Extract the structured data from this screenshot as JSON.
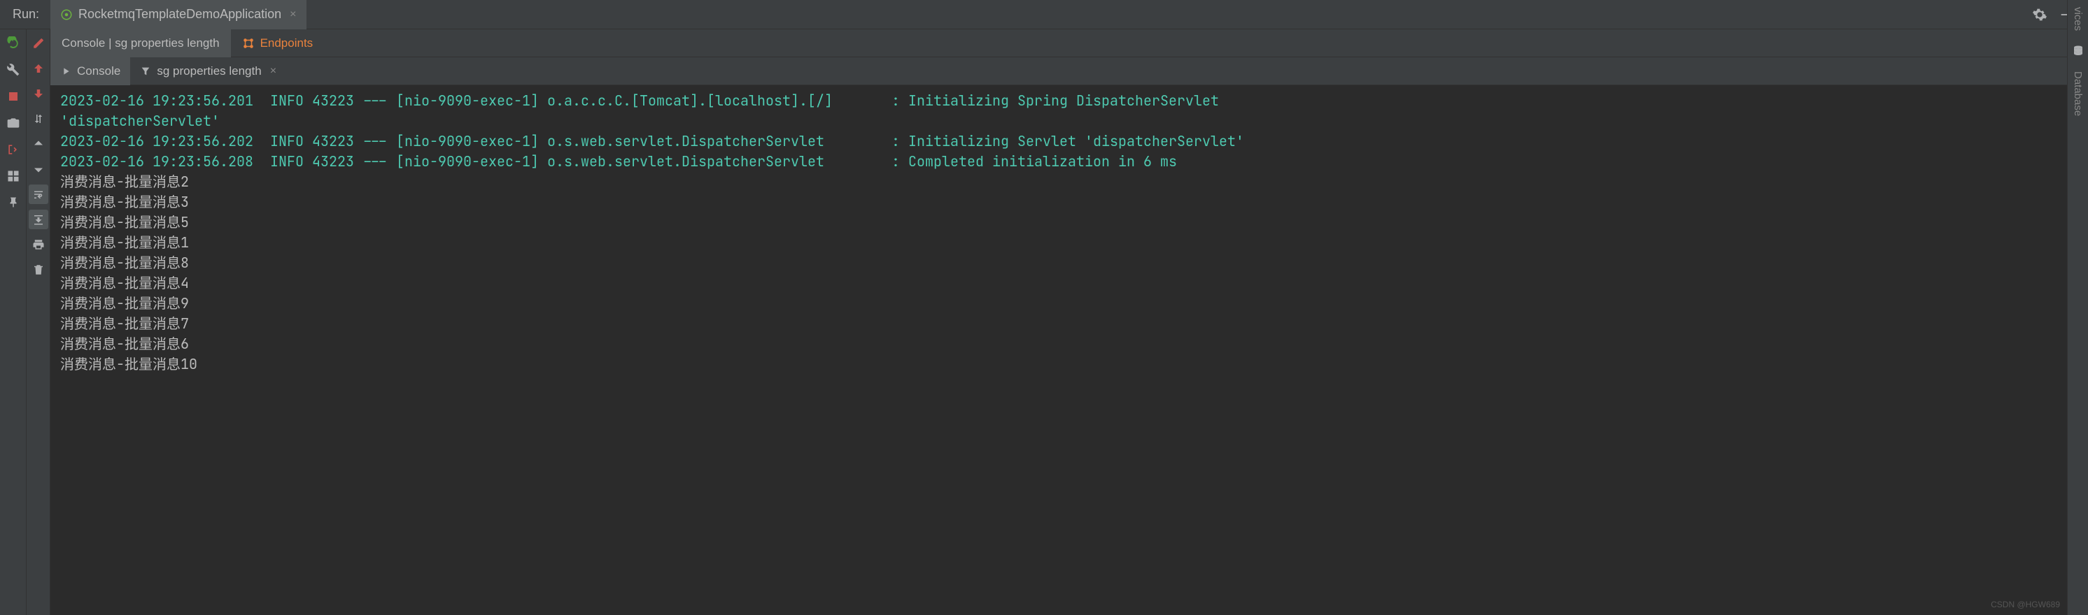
{
  "header": {
    "run_label": "Run:",
    "config_name": "RocketmqTemplateDemoApplication"
  },
  "sub_tabs": {
    "console_tab": "Console | sg properties length",
    "endpoints_tab": "Endpoints"
  },
  "inner_tabs": {
    "console": "Console",
    "filter": "sg properties length"
  },
  "right_sidebar": {
    "services": "vices",
    "database": "Database"
  },
  "log_lines": [
    "2023-02-16 19:23:56.201  INFO 43223 --- [nio-9090-exec-1] o.a.c.c.C.[Tomcat].[localhost].[/]       : Initializing Spring DispatcherServlet",
    "'dispatcherServlet'",
    "2023-02-16 19:23:56.202  INFO 43223 --- [nio-9090-exec-1] o.s.web.servlet.DispatcherServlet        : Initializing Servlet 'dispatcherServlet'",
    "2023-02-16 19:23:56.208  INFO 43223 --- [nio-9090-exec-1] o.s.web.servlet.DispatcherServlet        : Completed initialization in 6 ms"
  ],
  "msg_lines": [
    "消费消息-批量消息2",
    "消费消息-批量消息3",
    "消费消息-批量消息5",
    "消费消息-批量消息1",
    "消费消息-批量消息8",
    "消费消息-批量消息4",
    "消费消息-批量消息9",
    "消费消息-批量消息7",
    "消费消息-批量消息6",
    "消费消息-批量消息10"
  ],
  "watermark": "CSDN @HGW689",
  "colors": {
    "log_green": "#4ec9b0",
    "text_gray": "#bbbbbb",
    "bg_dark": "#2b2b2b",
    "bg_panel": "#3c3f41",
    "orange": "#e8823d"
  }
}
